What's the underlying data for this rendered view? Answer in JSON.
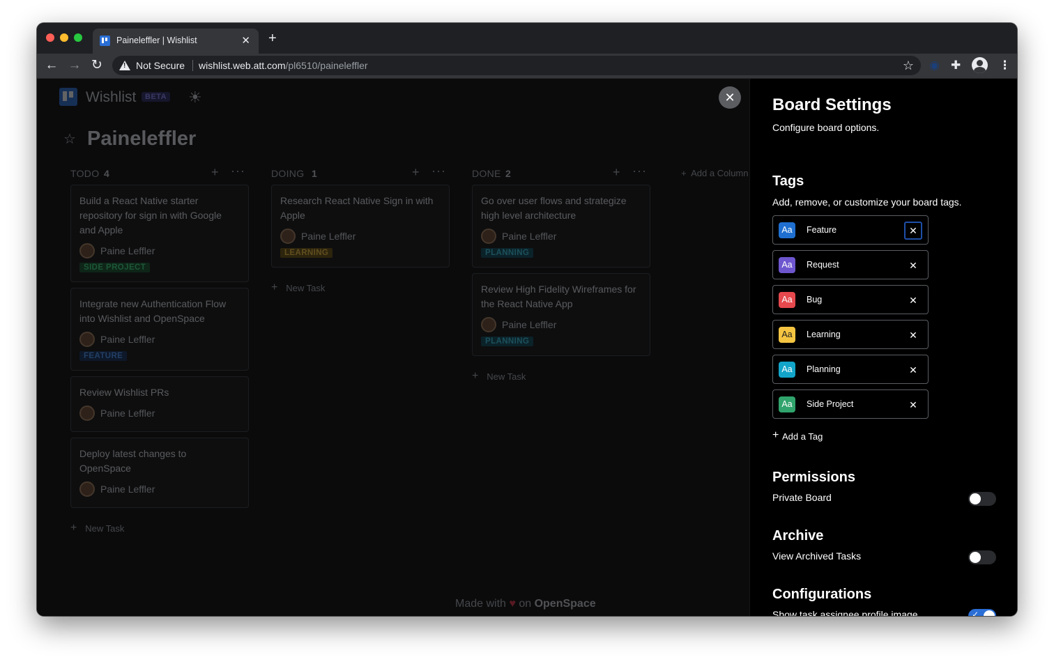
{
  "browser": {
    "tab_title": "Paineleffler | Wishlist",
    "security_label": "Not Secure",
    "url_host": "wishlist.web.att.com",
    "url_path": "/pl6510/paineleffler"
  },
  "app": {
    "name": "Wishlist",
    "badge": "BETA",
    "board_title": "Paineleffler",
    "add_column_label": "Add a Column",
    "footer": {
      "prefix": "Made with",
      "suffix": "on",
      "brand": "OpenSpace"
    }
  },
  "columns": [
    {
      "name": "TODO",
      "count": "4",
      "new_task_label": "New Task",
      "cards": [
        {
          "title": "Build a React Native starter repository for sign in with Google and Apple",
          "assignee": "Paine Leffler",
          "tag": "SIDE PROJECT"
        },
        {
          "title": "Integrate new Authentication Flow into Wishlist and OpenSpace",
          "assignee": "Paine Leffler",
          "tag": "FEATURE"
        },
        {
          "title": "Review Wishlist PRs",
          "assignee": "Paine Leffler",
          "tag": null
        },
        {
          "title": "Deploy latest changes to OpenSpace",
          "assignee": "Paine Leffler",
          "tag": null
        }
      ]
    },
    {
      "name": "DOING",
      "count": "1",
      "new_task_label": "New Task",
      "cards": [
        {
          "title": "Research React Native Sign in with Apple",
          "assignee": "Paine Leffler",
          "tag": "LEARNING"
        }
      ]
    },
    {
      "name": "DONE",
      "count": "2",
      "new_task_label": "New Task",
      "cards": [
        {
          "title": "Go over user flows and strategize high level architecture",
          "assignee": "Paine Leffler",
          "tag": "PLANNING"
        },
        {
          "title": "Review High Fidelity Wireframes for the React Native App",
          "assignee": "Paine Leffler",
          "tag": "PLANNING"
        }
      ]
    }
  ],
  "settings": {
    "title": "Board Settings",
    "subtitle": "Configure board options.",
    "tags_heading": "Tags",
    "tags_description": "Add, remove, or customize your board tags.",
    "tags": [
      {
        "glyph": "Aa",
        "name": "Feature",
        "color": "#1f6fd1"
      },
      {
        "glyph": "Aa",
        "name": "Request",
        "color": "#6e56cf"
      },
      {
        "glyph": "Aa",
        "name": "Bug",
        "color": "#e5484d"
      },
      {
        "glyph": "Aa",
        "name": "Learning",
        "color": "#f5c542"
      },
      {
        "glyph": "Aa",
        "name": "Planning",
        "color": "#12a5c9"
      },
      {
        "glyph": "Aa",
        "name": "Side Project",
        "color": "#30a46c"
      }
    ],
    "add_tag_label": "Add a Tag",
    "permissions_heading": "Permissions",
    "private_board_label": "Private Board",
    "private_board_enabled": false,
    "archive_heading": "Archive",
    "view_archived_label": "View Archived Tasks",
    "view_archived_enabled": false,
    "configurations_heading": "Configurations",
    "show_assignee_label": "Show task assignee profile image",
    "show_assignee_enabled": true
  },
  "tag_colors": {
    "SIDE PROJECT": {
      "fg": "#3ddc84",
      "bg": "#14532d"
    },
    "FEATURE": {
      "fg": "#4d9bff",
      "bg": "#12315e"
    },
    "LEARNING": {
      "fg": "#f5c542",
      "bg": "#6b5210"
    },
    "PLANNING": {
      "fg": "#3ccbe8",
      "bg": "#0c4b5c"
    }
  }
}
